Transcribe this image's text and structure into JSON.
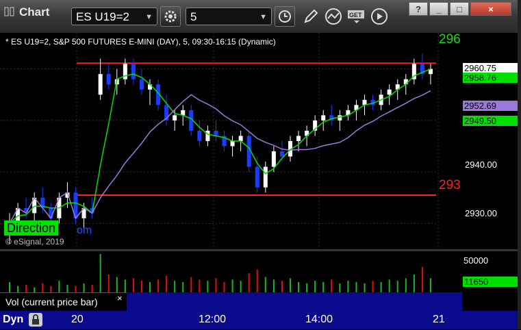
{
  "app": {
    "title": "Chart"
  },
  "toolbar": {
    "symbol": "ES U19=2",
    "interval": "5",
    "win_help": "?",
    "win_min": "_",
    "win_max": "□",
    "win_close": "×"
  },
  "chart": {
    "header": "* ES U19=2, S&P 500 FUTURES E-MINI (DAY), 5, 09:30-16:15 (Dynamic)",
    "direction_label": "Direction",
    "com_fragment": "om",
    "copyright": "© eSignal, 2019",
    "left_edge_text_top": "296",
    "left_edge_text_bottom": "293"
  },
  "price_axis": {
    "ticks": [
      "2940.00",
      "2930.00"
    ],
    "tags": {
      "last": "2960.75",
      "green1": "2958.76",
      "purple": "2952.69",
      "green2": "2949.50"
    }
  },
  "volume": {
    "tick": "50000",
    "tag": "11650",
    "legend": "Vol (current price bar)",
    "legend_close": "×"
  },
  "time_axis": {
    "prefix": "Dyn",
    "labels": [
      "20",
      "12:00",
      "14:00",
      "21"
    ]
  },
  "colors": {
    "up_candle": "#ffffff",
    "down_candle": "#1a3cff",
    "red_line": "#ff2020",
    "green_line": "#00e000",
    "purple_line": "#9a7ad8",
    "vol_up": "#1bb81b",
    "vol_down": "#e01010"
  },
  "chart_data": {
    "type": "candlestick",
    "ylim": [
      2925,
      2967
    ],
    "levels": {
      "resistance": 2961.1,
      "support": 2935.5
    },
    "candles": [
      [
        2928,
        2932,
        2926,
        2930
      ],
      [
        2930,
        2934,
        2928,
        2933
      ],
      [
        2933,
        2935,
        2931,
        2932
      ],
      [
        2932,
        2936,
        2930,
        2935
      ],
      [
        2935,
        2937,
        2932,
        2933
      ],
      [
        2933,
        2934,
        2929,
        2931
      ],
      [
        2931,
        2936,
        2930,
        2935
      ],
      [
        2935,
        2938,
        2933,
        2936
      ],
      [
        2936,
        2937,
        2930,
        2931
      ],
      [
        2931,
        2934,
        2929,
        2933
      ],
      [
        2933,
        2935,
        2931,
        2932
      ],
      [
        2955,
        2962,
        2954,
        2959
      ],
      [
        2959,
        2961,
        2956,
        2957
      ],
      [
        2957,
        2960,
        2955,
        2958
      ],
      [
        2958,
        2962,
        2957,
        2961
      ],
      [
        2961,
        2962,
        2957,
        2958
      ],
      [
        2958,
        2960,
        2955,
        2956
      ],
      [
        2956,
        2958,
        2953,
        2957
      ],
      [
        2957,
        2958,
        2952,
        2953
      ],
      [
        2953,
        2955,
        2949,
        2950
      ],
      [
        2950,
        2952,
        2948,
        2951
      ],
      [
        2951,
        2953,
        2949,
        2952
      ],
      [
        2952,
        2953,
        2947,
        2948
      ],
      [
        2948,
        2950,
        2945,
        2946
      ],
      [
        2946,
        2949,
        2945,
        2948
      ],
      [
        2948,
        2950,
        2946,
        2947
      ],
      [
        2947,
        2948,
        2944,
        2945
      ],
      [
        2945,
        2947,
        2943,
        2946
      ],
      [
        2946,
        2948,
        2944,
        2947
      ],
      [
        2947,
        2948,
        2940,
        2941
      ],
      [
        2941,
        2943,
        2936,
        2937
      ],
      [
        2937,
        2942,
        2936,
        2941
      ],
      [
        2941,
        2945,
        2940,
        2944
      ],
      [
        2944,
        2946,
        2942,
        2943
      ],
      [
        2943,
        2947,
        2942,
        2946
      ],
      [
        2946,
        2948,
        2944,
        2947
      ],
      [
        2947,
        2949,
        2945,
        2948
      ],
      [
        2948,
        2951,
        2947,
        2950
      ],
      [
        2950,
        2952,
        2948,
        2951
      ],
      [
        2951,
        2953,
        2949,
        2950
      ],
      [
        2950,
        2952,
        2948,
        2951
      ],
      [
        2951,
        2953,
        2950,
        2952
      ],
      [
        2952,
        2954,
        2950,
        2953
      ],
      [
        2953,
        2955,
        2951,
        2954
      ],
      [
        2954,
        2955,
        2952,
        2953
      ],
      [
        2953,
        2956,
        2952,
        2955
      ],
      [
        2955,
        2957,
        2953,
        2956
      ],
      [
        2956,
        2958,
        2954,
        2957
      ],
      [
        2957,
        2959,
        2955,
        2958
      ],
      [
        2958,
        2962,
        2957,
        2961
      ],
      [
        2961,
        2963,
        2958,
        2959
      ],
      [
        2959,
        2961,
        2957,
        2960
      ]
    ],
    "volumes": [
      8,
      5,
      6,
      4,
      7,
      5,
      9,
      6,
      5,
      7,
      6,
      30,
      14,
      12,
      10,
      11,
      9,
      8,
      10,
      13,
      9,
      8,
      12,
      10,
      9,
      11,
      8,
      10,
      9,
      15,
      18,
      12,
      10,
      9,
      11,
      8,
      7,
      9,
      8,
      10,
      7,
      9,
      8,
      7,
      9,
      8,
      10,
      9,
      11,
      14,
      20,
      11
    ]
  }
}
